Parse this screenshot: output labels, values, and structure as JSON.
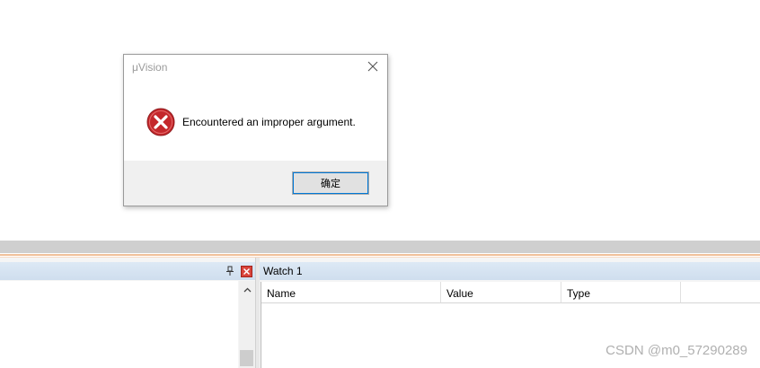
{
  "dialog": {
    "title": "μVision",
    "message": "Encountered an improper argument.",
    "ok_label": "确定"
  },
  "watch": {
    "title": "Watch 1",
    "columns": [
      "Name",
      "Value",
      "Type"
    ]
  },
  "watermark": "CSDN @m0_57290289",
  "icons": {
    "error": "error-icon",
    "close": "close-icon",
    "pin": "pin-icon",
    "scroll_up": "chevron-up-icon"
  },
  "colors": {
    "error_red": "#c4282c",
    "accent": "#0078d7",
    "orange_separator": "#f0c09a"
  }
}
